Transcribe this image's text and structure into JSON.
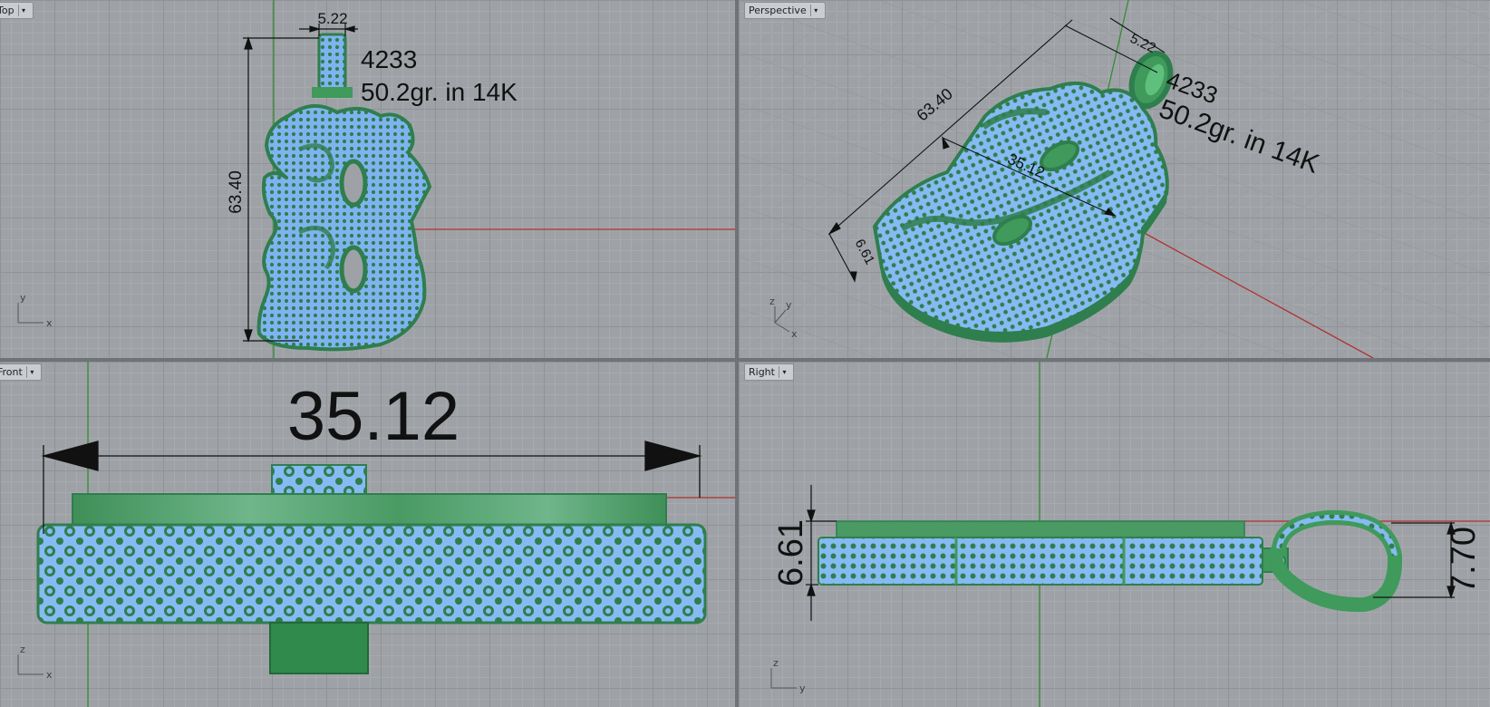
{
  "viewports": {
    "top": {
      "label": "Top",
      "dims": {
        "bail_width": "5.22",
        "height": "63.40"
      },
      "annotation": {
        "model_no": "4233",
        "weight": "50.2gr. in 14K"
      },
      "axes": {
        "a": "y",
        "b": "x"
      }
    },
    "perspective": {
      "label": "Perspective",
      "dims": {
        "bail_width": "5.22",
        "height": "63.40",
        "width": "35.12",
        "depth": "6.61"
      },
      "annotation": {
        "model_no": "4233",
        "weight": "50.2gr. in 14K"
      },
      "axes": {
        "a": "z",
        "b": "y",
        "c": "x"
      }
    },
    "front": {
      "label": "Front",
      "dims": {
        "width": "35.12"
      },
      "axes": {
        "a": "z",
        "b": "x"
      }
    },
    "right": {
      "label": "Right",
      "dims": {
        "depth": "6.61",
        "bail_height": "7.70"
      },
      "axes": {
        "a": "z",
        "b": "y"
      }
    }
  },
  "colors": {
    "grid_bg": "#9ea2a6",
    "gem_blue": "#7fb3f0",
    "metal_green": "#3f9a5c",
    "axis_x": "#b03030",
    "axis_y": "#2e8a2e"
  },
  "icons": {
    "dropdown": "caret-down-icon"
  }
}
